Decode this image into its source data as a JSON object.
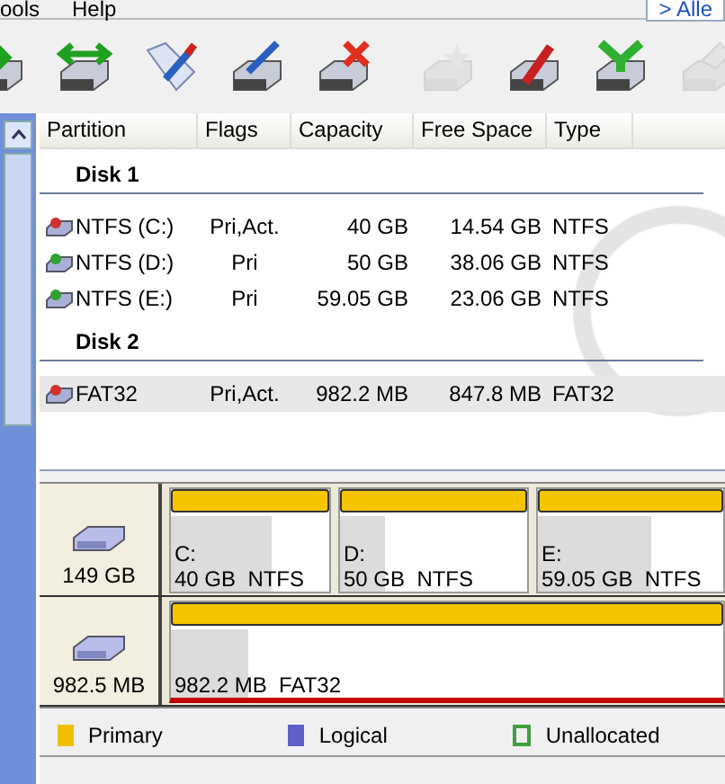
{
  "menu": [
    {
      "label": "ools"
    },
    {
      "label": "Help"
    }
  ],
  "top_tab": {
    "label": "> Alle"
  },
  "toolbar": [
    {
      "kind": "drive-arrow",
      "disabled": false
    },
    {
      "kind": "drive-resize",
      "disabled": false
    },
    {
      "kind": "tag-pen",
      "disabled": false
    },
    {
      "kind": "drive-pen",
      "disabled": false
    },
    {
      "kind": "drive-delete",
      "disabled": false
    },
    {
      "kind": "drive-star",
      "disabled": true
    },
    {
      "kind": "drive-brush",
      "disabled": false
    },
    {
      "kind": "drive-down",
      "disabled": false
    },
    {
      "kind": "drive-gray",
      "disabled": true
    }
  ],
  "table": {
    "columns": [
      "Partition",
      "Flags",
      "Capacity",
      "Free Space",
      "Type"
    ],
    "groups": [
      {
        "title": "Disk 1",
        "rows": [
          {
            "cells": [
              "NTFS (C:)",
              "Pri,Act.",
              "40 GB",
              "14.54 GB",
              "NTFS"
            ],
            "active": true,
            "selected": false
          },
          {
            "cells": [
              "NTFS (D:)",
              "Pri",
              "50 GB",
              "38.06 GB",
              "NTFS"
            ],
            "active": false,
            "selected": false
          },
          {
            "cells": [
              "NTFS (E:)",
              "Pri",
              "59.05 GB",
              "23.06 GB",
              "NTFS"
            ],
            "active": false,
            "selected": false
          }
        ]
      },
      {
        "title": "Disk 2",
        "rows": [
          {
            "cells": [
              "FAT32",
              "Pri,Act.",
              "982.2 MB",
              "847.8 MB",
              "FAT32"
            ],
            "active": true,
            "selected": true
          }
        ]
      }
    ]
  },
  "disk_map": [
    {
      "size": "149 GB",
      "partitions": [
        {
          "letter": "C:",
          "info": "40 GB  NTFS",
          "level": 0.64,
          "selected": false
        },
        {
          "letter": "D:",
          "info": "50 GB  NTFS",
          "level": 0.24,
          "selected": false
        },
        {
          "letter": "E:",
          "info": "59.05 GB  NTFS",
          "level": 0.61,
          "selected": false
        }
      ]
    },
    {
      "size": "982.5 MB",
      "partitions": [
        {
          "info": "982.2 MB  FAT32",
          "level": 0.14,
          "selected": true
        }
      ]
    }
  ],
  "legend": [
    {
      "label": "Primary",
      "color": "#f0c000",
      "kind": "fill"
    },
    {
      "label": "Logical",
      "color": "#6060c8",
      "kind": "fill"
    },
    {
      "label": "Unallocated",
      "color": "#40a040",
      "kind": "outline"
    }
  ]
}
